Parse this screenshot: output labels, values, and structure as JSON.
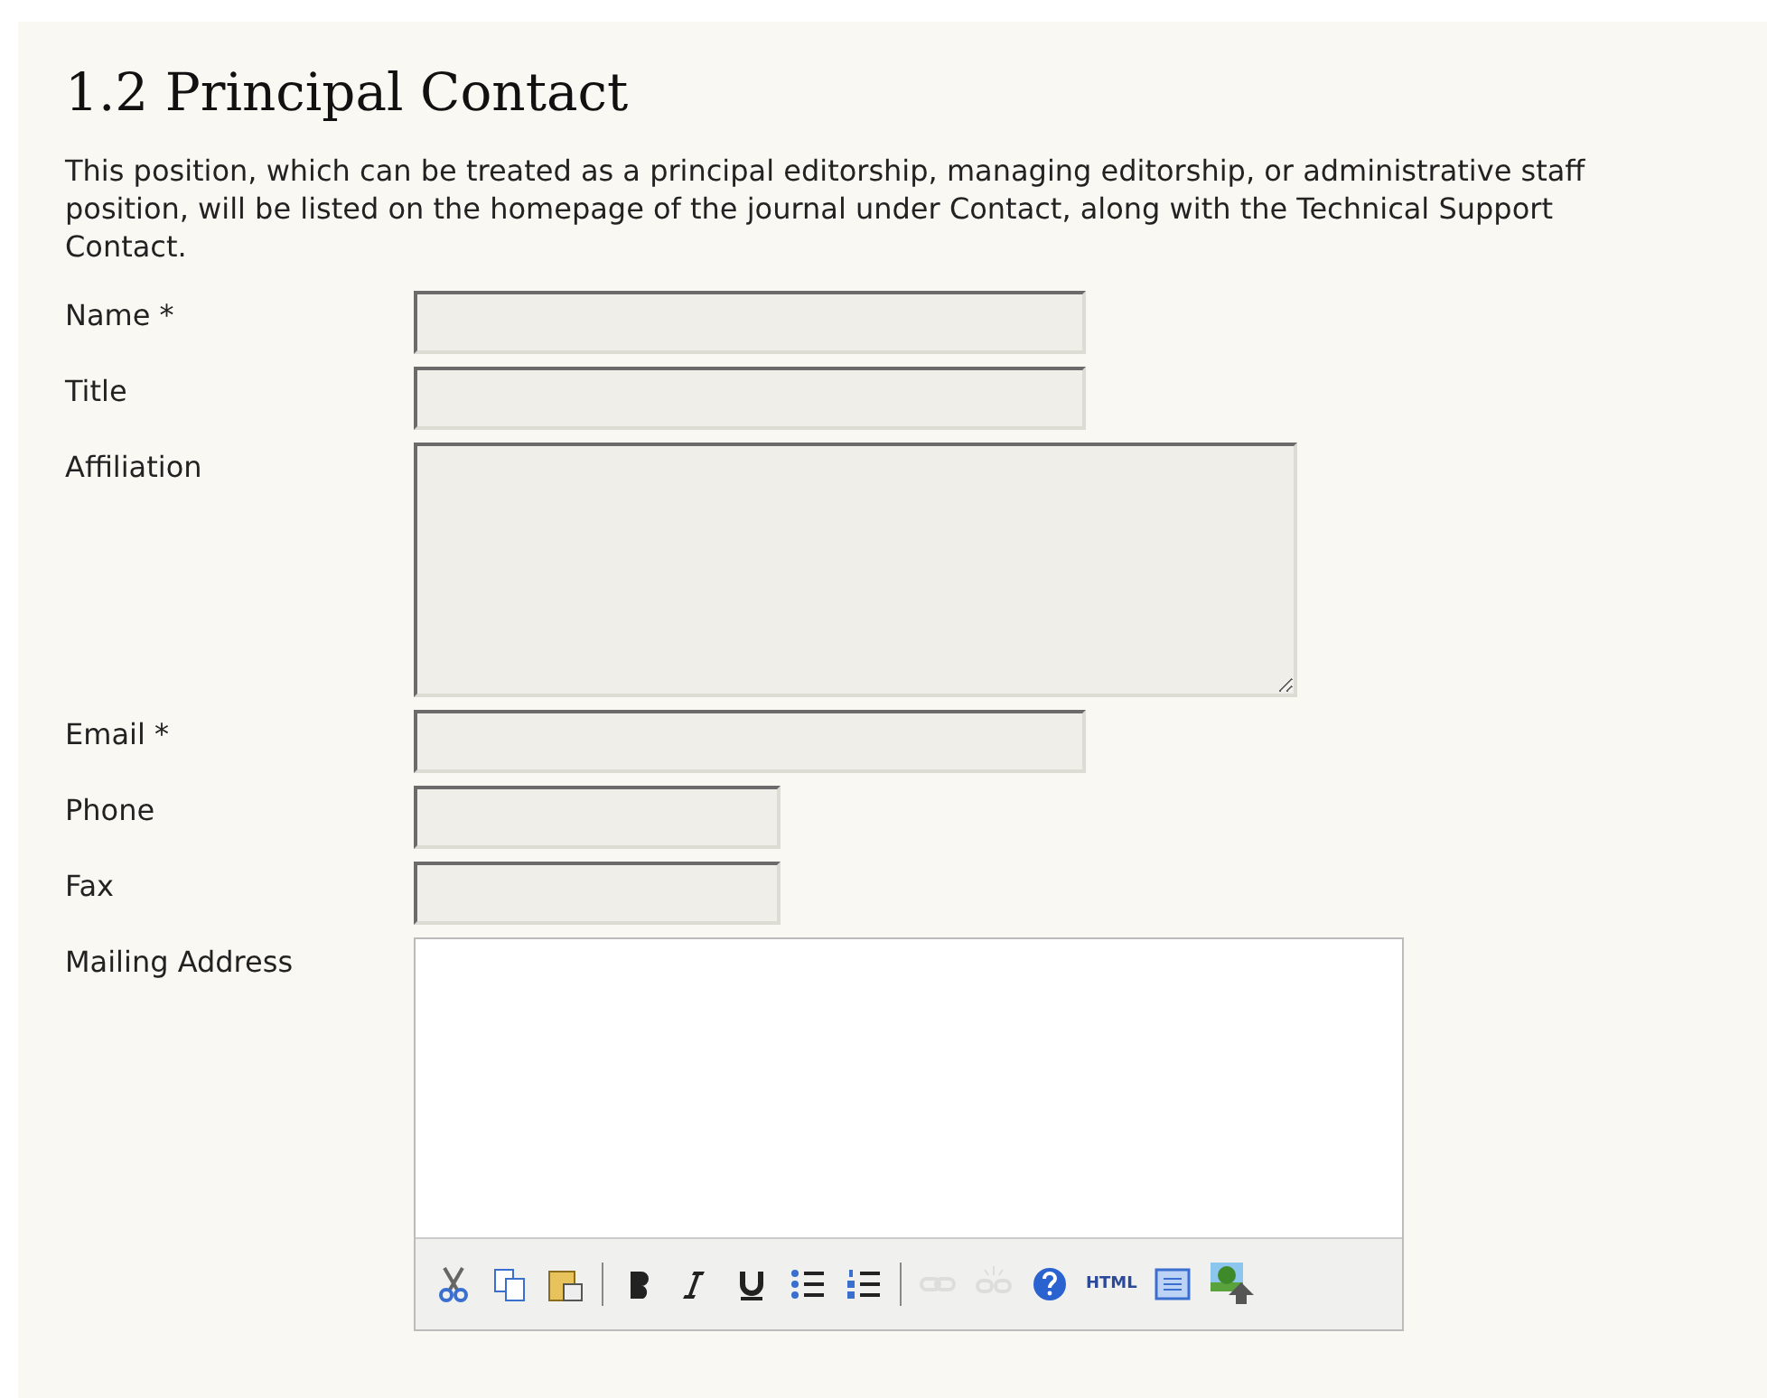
{
  "section": {
    "title": "1.2 Principal Contact",
    "description": "This position, which can be treated as a principal editorship, managing editorship, or administrative staff position, will be listed on the homepage of the journal under Contact, along with the Technical Support Contact."
  },
  "fields": [
    {
      "label": "Name *",
      "kind": "longtext"
    },
    {
      "label": "Title",
      "kind": "longtext"
    },
    {
      "label": "Affiliation",
      "kind": "textarea"
    },
    {
      "label": "Email *",
      "kind": "longtext"
    },
    {
      "label": "Phone",
      "kind": "shorttext"
    },
    {
      "label": "Fax",
      "kind": "shorttext"
    },
    {
      "label": "Mailing Address",
      "kind": "richtext"
    }
  ],
  "toolbar": [
    {
      "kind": "cut",
      "disabled": false
    },
    {
      "kind": "copy",
      "disabled": false
    },
    {
      "kind": "paste",
      "disabled": false
    },
    {
      "kind": "separator"
    },
    {
      "kind": "bold",
      "disabled": false
    },
    {
      "kind": "italic",
      "disabled": false
    },
    {
      "kind": "underline",
      "disabled": false
    },
    {
      "kind": "bullets",
      "disabled": false
    },
    {
      "kind": "numbers",
      "disabled": false
    },
    {
      "kind": "separator"
    },
    {
      "kind": "link",
      "disabled": true
    },
    {
      "kind": "unlink",
      "disabled": true
    },
    {
      "kind": "help",
      "disabled": false
    },
    {
      "kind": "html",
      "label": "HTML",
      "disabled": false
    },
    {
      "kind": "fullscreen",
      "disabled": false
    },
    {
      "kind": "image",
      "disabled": false
    }
  ]
}
